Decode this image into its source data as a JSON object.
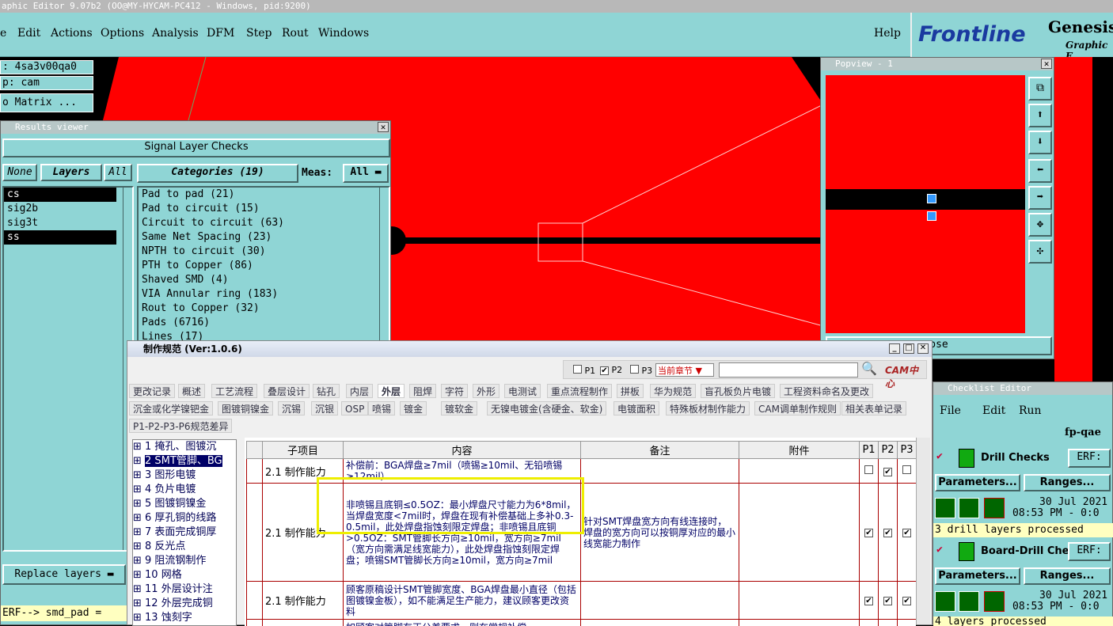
{
  "app": {
    "title": "aphic Editor 9.07b2 (OO@MY-HYCAM-PC412 - Windows, pid:9200)"
  },
  "menu": [
    "e",
    "Edit",
    "Actions",
    "Options",
    "Analysis",
    "DFM",
    "Step",
    "Rout",
    "Windows"
  ],
  "help": "Help",
  "brand": {
    "logo": "Frontline",
    "product": "Genesis",
    "sub": "Graphic E"
  },
  "left_info": {
    "job": ": 4sa3v00qa0",
    "step": "p: cam",
    "matrix": "o Matrix ..."
  },
  "results": {
    "title": "Results viewer",
    "header": "Signal Layer Checks",
    "none": "None",
    "layers": "Layers",
    "all": "All",
    "categories": "Categories (19)",
    "meas": "Meas:",
    "meas_val": "All",
    "layer_list": [
      "cs",
      "sig2b",
      "sig3t",
      "ss"
    ],
    "cat_list": [
      "Pad to pad (21)",
      "Pad to circuit (15)",
      "Circuit to circuit (63)",
      "Same Net Spacing (23)",
      "NPTH to circuit (30)",
      "PTH to Copper (86)",
      "Shaved SMD (4)",
      "VIA Annular ring (183)",
      "Rout to Copper (32)",
      "Pads (6716)",
      "Lines (17)"
    ],
    "replace": "Replace layers",
    "erf": "ERF--> smd_pad ="
  },
  "popview": {
    "title": "Popview - 1",
    "close": "ose"
  },
  "zhi": {
    "title": "制作规范 (Ver:1.0.6)",
    "p1": "P1",
    "p2": "P2",
    "p3": "P3",
    "chapter": "当前章节",
    "cam": "CAM中心",
    "tabs_row1": [
      "更改记录",
      "概述",
      "工艺流程",
      "叠层设计",
      "钻孔",
      "内层",
      "外层",
      "阻焊",
      "字符",
      "外形",
      "电测试",
      "重点流程制作",
      "拼板",
      "华为规范",
      "盲孔板负片电镀",
      "工程资料命名及更改"
    ],
    "tabs_row2": [
      "沉金或化学镍钯金",
      "图镀铜镍金",
      "沉锡",
      "沉银",
      "OSP",
      "喷锡",
      "镀金",
      "镀软金",
      "无镍电镀金(含硬金、软金)",
      "电镀面积",
      "特殊板材制作能力",
      "CAM调单制作规则",
      "相关表单记录"
    ],
    "tabs_row3": [
      "P1-P2-P3-P6规范差异"
    ],
    "tree": [
      "1 掩孔、图镀沉",
      "2 SMT管脚、BG",
      "3 图形电镀",
      "4 负片电镀",
      "5 图镀铜镍金",
      "6 厚孔铜的线路",
      "7 表面完成铜厚",
      "8 反光点",
      "9 阻流钢制作",
      "10 网格",
      "11 外层设计注",
      "12 外层完成铜",
      "13 蚀刻字"
    ],
    "cols": [
      "子项目",
      "内容",
      "备注",
      "附件",
      "P1",
      "P2",
      "P3"
    ],
    "rows": [
      {
        "sub": "2.1 制作能力",
        "content": "补偿前：BGA焊盘≥7mil（喷锡≥10mil、无铅喷锡≥12mil）",
        "note": ""
      },
      {
        "sub": "2.1 制作能力",
        "content": "非喷锡且底铜≤0.5OZ：最小焊盘尺寸能力为6*8mil，当焊盘宽度<7mil时，焊盘在现有补偿基础上多补0.3-0.5mil，此处焊盘指蚀刻限定焊盘；非喷锡且底铜>0.5OZ：SMT管脚长方向≥10mil，宽方向≥7mil（宽方向需满足线宽能力），此处焊盘指蚀刻限定焊盘；喷锡SMT管脚长方向≥10mil，宽方向≥7mil",
        "note": "针对SMT焊盘宽方向有线连接时，焊盘的宽方向可以按铜厚对应的最小线宽能力制作"
      },
      {
        "sub": "2.1 制作能力",
        "content": "顾客原稿设计SMT管脚宽度、BGA焊盘最小直径（包括图镀镍金板），如不能满足生产能力，建议顾客更改资料",
        "note": ""
      },
      {
        "sub": "",
        "content": "如顾客对管脚有正公差要求，则在常规补偿",
        "note": ""
      }
    ]
  },
  "checklist": {
    "title": "Checklist Editor",
    "menu": [
      "File",
      "Edit",
      "Run"
    ],
    "name": "fp-qae",
    "items": [
      {
        "name": "Drill Checks",
        "erf": "ERF:",
        "params": "Parameters...",
        "ranges": "Ranges...",
        "date": "30 Jul 2021",
        "time": "08:53 PM - 0:0",
        "status": "3 drill layers processed"
      },
      {
        "name": "Board-Drill Che",
        "erf": "ERF:",
        "params": "Parameters...",
        "ranges": "Ranges...",
        "date": "30 Jul 2021",
        "time": "08:53 PM - 0:0",
        "status": "4 layers processed"
      }
    ]
  }
}
